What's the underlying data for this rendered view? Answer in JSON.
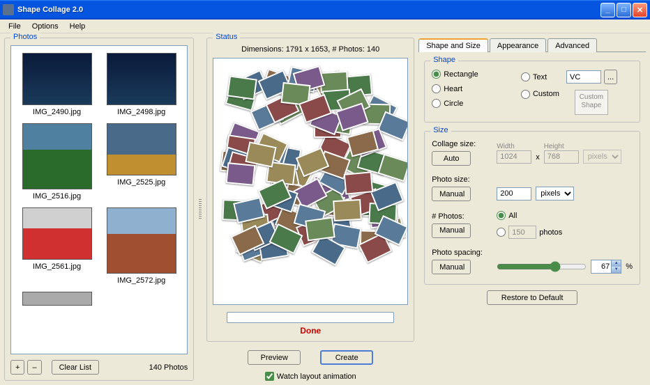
{
  "window": {
    "title": "Shape Collage 2.0"
  },
  "menu": {
    "file": "File",
    "options": "Options",
    "help": "Help"
  },
  "photos": {
    "legend": "Photos",
    "items": [
      {
        "name": "IMG_2490.jpg",
        "cls": "night"
      },
      {
        "name": "IMG_2498.jpg",
        "cls": "night"
      },
      {
        "name": "IMG_2516.jpg",
        "cls": "tree"
      },
      {
        "name": "IMG_2525.jpg",
        "cls": "domes"
      },
      {
        "name": "IMG_2561.jpg",
        "cls": "metro"
      },
      {
        "name": "IMG_2572.jpg",
        "cls": "church"
      },
      {
        "name": "",
        "cls": "gray"
      }
    ],
    "add": "+",
    "remove": "–",
    "clear": "Clear List",
    "count": "140 Photos"
  },
  "status": {
    "legend": "Status",
    "dimensions": "Dimensions: 1791 x 1653, # Photos: 140",
    "done": "Done",
    "preview": "Preview",
    "create": "Create",
    "watch": "Watch layout animation"
  },
  "tabs": {
    "t0": "Shape and Size",
    "t1": "Appearance",
    "t2": "Advanced"
  },
  "shape": {
    "legend": "Shape",
    "rectangle": "Rectangle",
    "heart": "Heart",
    "circle": "Circle",
    "text": "Text",
    "text_value": "VC",
    "dots": "...",
    "custom": "Custom",
    "custom_box": "Custom Shape"
  },
  "size": {
    "legend": "Size",
    "collage_label": "Collage size:",
    "auto": "Auto",
    "width_label": "Width",
    "width_val": "1024",
    "height_label": "Height",
    "height_val": "768",
    "x": "x",
    "units": "pixels",
    "photo_label": "Photo size:",
    "manual": "Manual",
    "photo_val": "200",
    "num_label": "# Photos:",
    "all": "All",
    "num_val": "150",
    "photos_word": "photos",
    "spacing_label": "Photo spacing:",
    "spacing_val": "67",
    "percent": "%"
  },
  "restore": "Restore to Default"
}
